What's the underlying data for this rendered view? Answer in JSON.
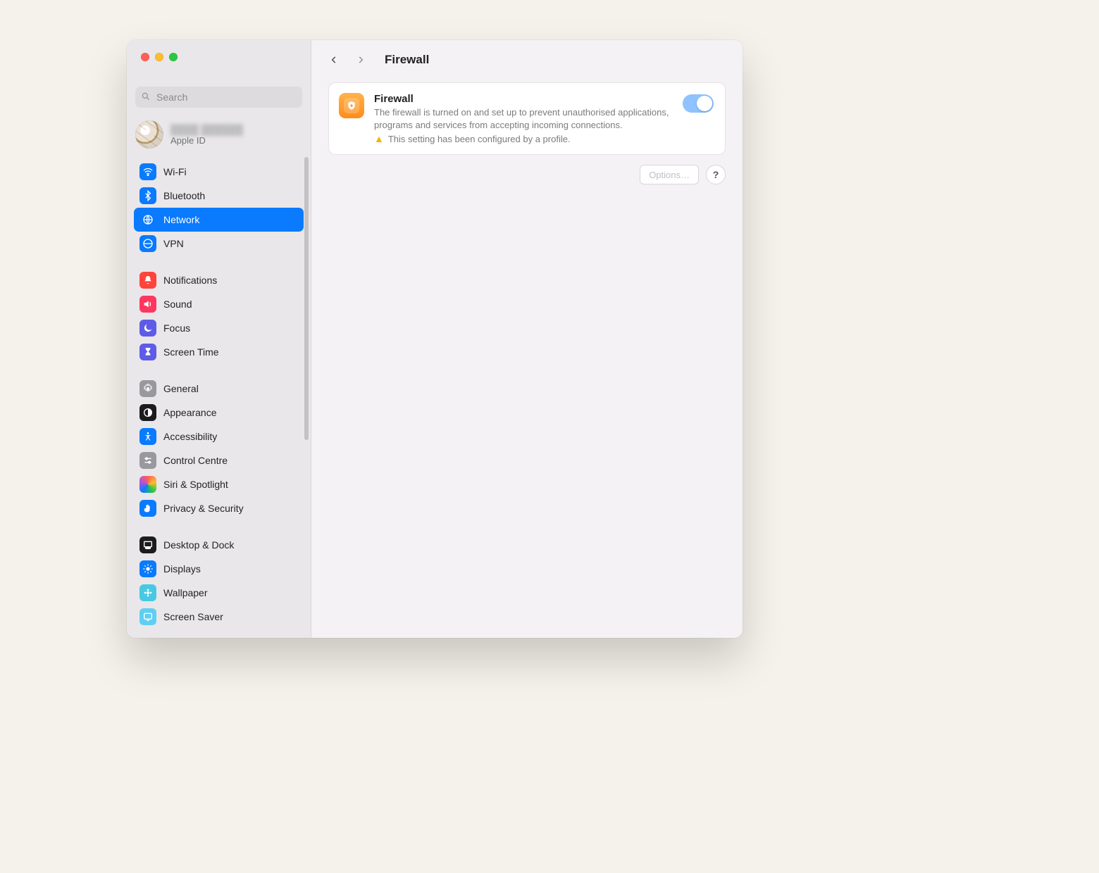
{
  "search": {
    "placeholder": "Search"
  },
  "account": {
    "name": "████ ██████",
    "sub": "Apple ID"
  },
  "sidebar": {
    "groups": [
      {
        "items": [
          {
            "label": "Wi-Fi"
          },
          {
            "label": "Bluetooth"
          },
          {
            "label": "Network"
          },
          {
            "label": "VPN"
          }
        ]
      },
      {
        "items": [
          {
            "label": "Notifications"
          },
          {
            "label": "Sound"
          },
          {
            "label": "Focus"
          },
          {
            "label": "Screen Time"
          }
        ]
      },
      {
        "items": [
          {
            "label": "General"
          },
          {
            "label": "Appearance"
          },
          {
            "label": "Accessibility"
          },
          {
            "label": "Control Centre"
          },
          {
            "label": "Siri & Spotlight"
          },
          {
            "label": "Privacy & Security"
          }
        ]
      },
      {
        "items": [
          {
            "label": "Desktop & Dock"
          },
          {
            "label": "Displays"
          },
          {
            "label": "Wallpaper"
          },
          {
            "label": "Screen Saver"
          }
        ]
      }
    ]
  },
  "header": {
    "title": "Firewall"
  },
  "firewall": {
    "title": "Firewall",
    "description": "The firewall is turned on and set up to prevent unauthorised applications, programs and services from accepting incoming connections.",
    "profile_note": "This setting has been configured by a profile.",
    "enabled": true
  },
  "buttons": {
    "options": "Options…",
    "help": "?"
  }
}
